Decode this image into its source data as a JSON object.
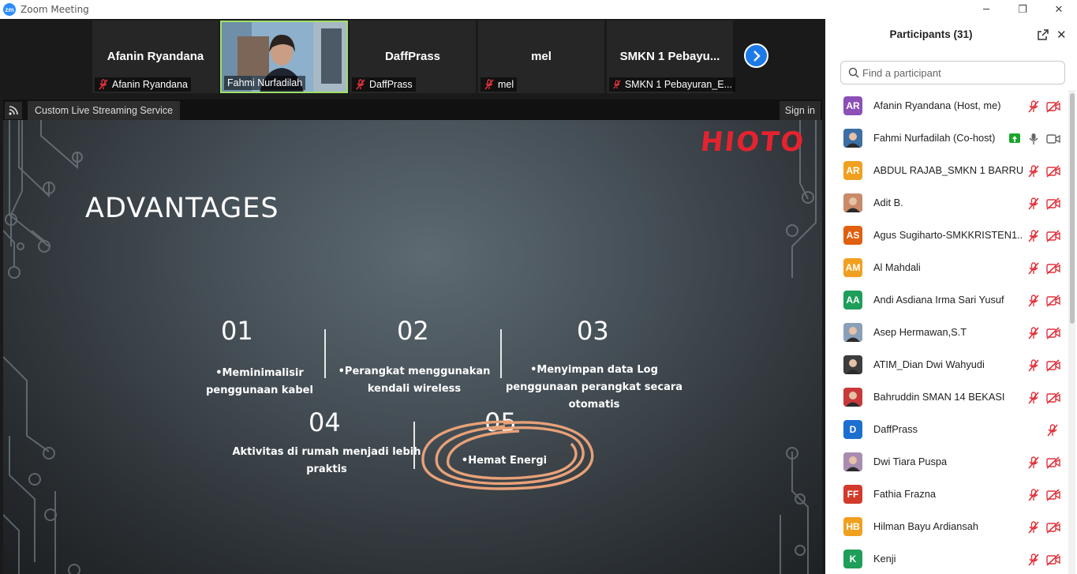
{
  "window": {
    "logo": "zm",
    "title": "Zoom Meeting",
    "controls": [
      "minimize-icon",
      "restore-icon",
      "close-icon"
    ]
  },
  "video_strip": {
    "tiles": [
      {
        "display_name": "Afanin Ryandana",
        "label": "Afanin Ryandana",
        "muted": true,
        "video": false
      },
      {
        "display_name": "",
        "label": "Fahmi Nurfadilah",
        "muted": false,
        "video": true
      },
      {
        "display_name": "DaffPrass",
        "label": "DaffPrass",
        "muted": true,
        "video": false
      },
      {
        "display_name": "mel",
        "label": "mel",
        "muted": true,
        "video": false
      },
      {
        "display_name": "SMKN  1  Pebayu...",
        "label": "SMKN 1 Pebayuran_E...",
        "muted": true,
        "video": false
      }
    ],
    "next_icon": "chevron-right-icon"
  },
  "share_toolbar": {
    "stream_label": "Custom Live Streaming Service",
    "signin_label": "Sign in"
  },
  "slide": {
    "brand": "HIOTO",
    "heading": "ADVANTAGES",
    "items": [
      {
        "num": "01",
        "line1": "•Meminimalisir",
        "line2": "penggunaan kabel",
        "line3": ""
      },
      {
        "num": "02",
        "line1": "•Perangkat  menggunakan",
        "line2": "kendali wireless",
        "line3": ""
      },
      {
        "num": "03",
        "line1": "•Menyimpan data Log",
        "line2": "penggunaan perangkat secara",
        "line3": "otomatis"
      },
      {
        "num": "04",
        "line1": "Aktivitas di rumah menjadi lebih",
        "line2": "praktis",
        "line3": ""
      },
      {
        "num": "05",
        "line1": "•Hemat Energi",
        "line2": "",
        "line3": ""
      }
    ],
    "annotation_color": "#e8a178"
  },
  "participants": {
    "title": "Participants (31)",
    "search_placeholder": "Find a participant",
    "list": [
      {
        "initials": "AR",
        "name": "Afanin Ryandana (Host, me)",
        "color": "#8c4fb6",
        "photo": false,
        "mic": "muted",
        "cam": "off"
      },
      {
        "initials": "",
        "name": "Fahmi Nurfadilah (Co-host)",
        "color": "#3b6fa6",
        "photo": true,
        "mic": "on",
        "cam": "on",
        "sharing": true
      },
      {
        "initials": "AR",
        "name": "ABDUL RAJAB_SMKN 1 BARRU",
        "color": "#f0a020",
        "photo": false,
        "mic": "muted",
        "cam": "off"
      },
      {
        "initials": "",
        "name": "Adit B.",
        "color": "#c98a6a",
        "photo": true,
        "mic": "muted",
        "cam": "off"
      },
      {
        "initials": "AS",
        "name": "Agus Sugiharto-SMKKRISTEN1...",
        "color": "#e06010",
        "photo": false,
        "mic": "muted",
        "cam": "off"
      },
      {
        "initials": "AM",
        "name": "Al Mahdali",
        "color": "#f0a020",
        "photo": false,
        "mic": "muted",
        "cam": "off"
      },
      {
        "initials": "AA",
        "name": "Andi Asdiana Irma Sari Yusuf",
        "color": "#1f9e5a",
        "photo": false,
        "mic": "muted",
        "cam": "off"
      },
      {
        "initials": "",
        "name": "Asep Hermawan,S.T",
        "color": "#8aa0b8",
        "photo": true,
        "mic": "muted",
        "cam": "off"
      },
      {
        "initials": "",
        "name": "ATIM_Dian Dwi Wahyudi",
        "color": "#3d3d3d",
        "photo": true,
        "mic": "muted",
        "cam": "off"
      },
      {
        "initials": "",
        "name": "Bahruddin SMAN 14 BEKASI",
        "color": "#c83a3a",
        "photo": true,
        "mic": "muted",
        "cam": "off"
      },
      {
        "initials": "D",
        "name": "DaffPrass",
        "color": "#1d6fcf",
        "photo": false,
        "mic": "muted",
        "cam": "none"
      },
      {
        "initials": "",
        "name": "Dwi Tiara Puspa",
        "color": "#a88db0",
        "photo": true,
        "mic": "muted",
        "cam": "off"
      },
      {
        "initials": "FF",
        "name": "Fathia Frazna",
        "color": "#d23a2a",
        "photo": false,
        "mic": "muted",
        "cam": "off"
      },
      {
        "initials": "HB",
        "name": "Hilman Bayu Ardiansah",
        "color": "#f0a020",
        "photo": false,
        "mic": "muted",
        "cam": "off"
      },
      {
        "initials": "K",
        "name": "Kenji",
        "color": "#1f9e5a",
        "photo": false,
        "mic": "muted",
        "cam": "off"
      }
    ]
  }
}
